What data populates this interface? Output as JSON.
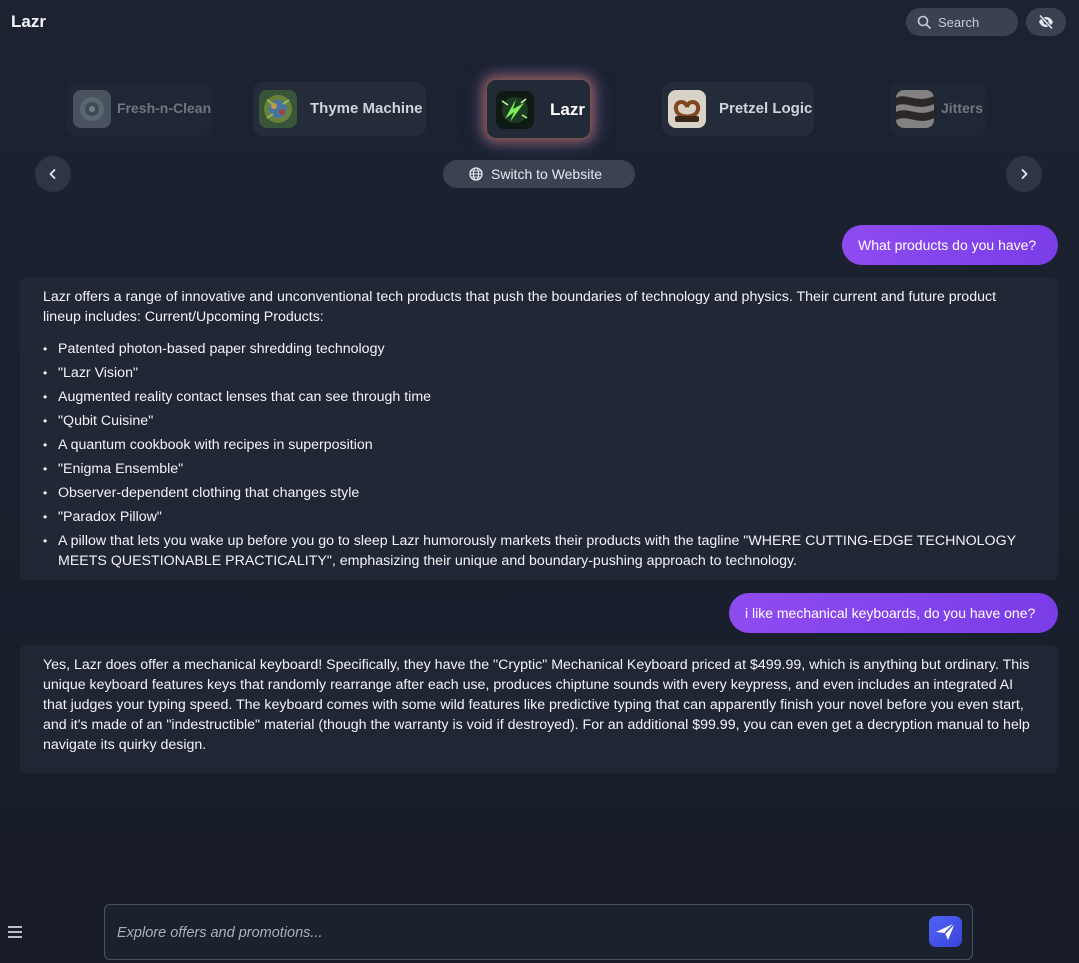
{
  "header": {
    "app_title": "Lazr",
    "search_placeholder": "Search"
  },
  "carousel": {
    "brands": [
      {
        "name": "Fresh-n-Clean",
        "active": false
      },
      {
        "name": "Thyme Machine",
        "active": false
      },
      {
        "name": "Lazr",
        "active": true
      },
      {
        "name": "Pretzel Logic",
        "active": false
      },
      {
        "name": "Jitters",
        "active": false
      }
    ],
    "switch_label": "Switch to Website"
  },
  "chat": {
    "user_1": "What products do you have?",
    "bot_1": {
      "intro": "Lazr offers a range of innovative and unconventional tech products that push the boundaries of technology and physics. Their current and future product lineup includes: Current/Upcoming Products:",
      "items": [
        "Patented photon-based paper shredding technology",
        "\"Lazr Vision\"",
        "Augmented reality contact lenses that can see through time",
        "\"Qubit Cuisine\"",
        "A quantum cookbook with recipes in superposition",
        "\"Enigma Ensemble\"",
        "Observer-dependent clothing that changes style",
        "\"Paradox Pillow\"",
        "A pillow that lets you wake up before you go to sleep Lazr humorously markets their products with the tagline \"WHERE CUTTING-EDGE TECHNOLOGY MEETS QUESTIONABLE PRACTICALITY\", emphasizing their unique and boundary-pushing approach to technology."
      ]
    },
    "user_2": "i like mechanical keyboards, do you have one?",
    "bot_2": "Yes, Lazr does offer a mechanical keyboard! Specifically, they have the \"Cryptic\" Mechanical Keyboard priced at $499.99, which is anything but ordinary. This unique keyboard features keys that randomly rearrange after each use, produces chiptune sounds with every keypress, and even includes an integrated AI that judges your typing speed. The keyboard comes with some wild features like predictive typing that can apparently finish your novel before you even start, and it's made of an \"indestructible\" material (though the warranty is void if destroyed). For an additional $99.99, you can even get a decryption manual to help navigate its quirky design."
  },
  "composer": {
    "placeholder": "Explore offers and promotions...",
    "value": ""
  },
  "colors": {
    "accent_purple": "#8e4bf0",
    "send_blue": "#4f63f5",
    "background": "#1c2230"
  },
  "icons": [
    "search-icon",
    "eye-off-icon",
    "chevron-left-icon",
    "chevron-right-icon",
    "globe-icon",
    "menu-icon",
    "send-icon"
  ]
}
